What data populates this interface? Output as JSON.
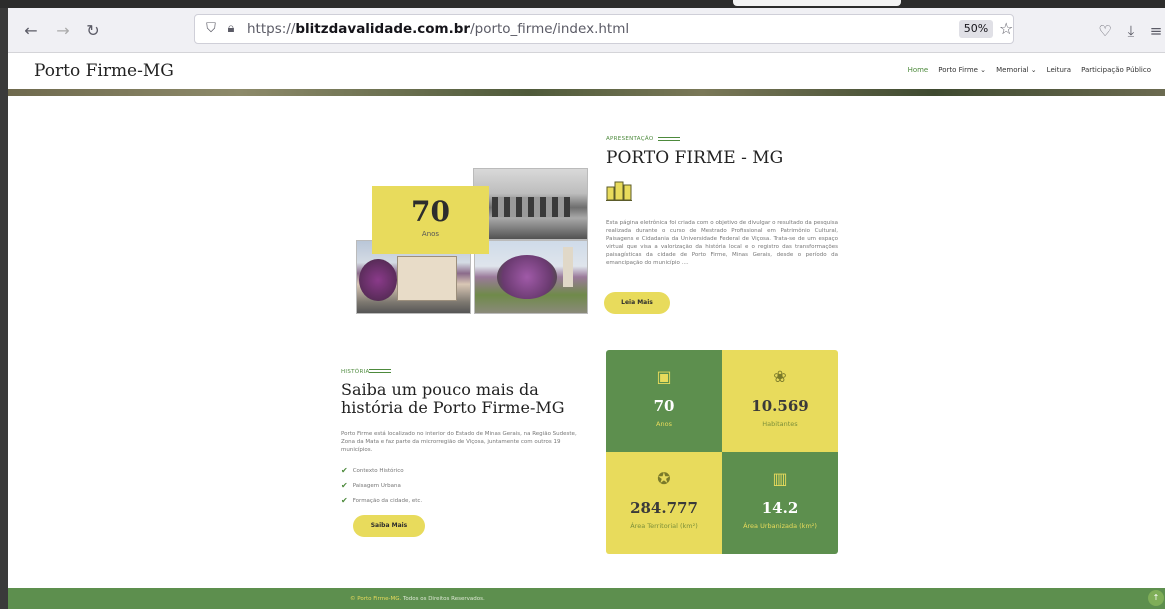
{
  "browser": {
    "back_icon": "arrow-left-icon",
    "forward_icon": "arrow-right-icon",
    "reload_icon": "reload-icon",
    "url_prefix": "https://",
    "url_domain": "blitzdavalidade.com.br",
    "url_path": "/porto_firme/index.html",
    "zoom": "50%"
  },
  "site": {
    "logo": "Porto Firme-MG",
    "nav": [
      "Home",
      "Porto Firme ⌄",
      "Memorial ⌄",
      "Leitura",
      "Participação Público"
    ]
  },
  "years_badge": {
    "value": "70",
    "label": "Anos"
  },
  "intro": {
    "eyebrow": "APRESENTAÇÃO",
    "title": "PORTO FIRME - MG",
    "text": "Esta página eletrônica foi criada com o objetivo de divulgar o resultado da pesquisa realizada durante o curso de Mestrado Profissional em Patrimônio Cultural, Paisagens e Cidadania da Universidade Federal de Viçosa. Trata-se de um espaço virtual que visa a valorização da história local e o registro das transformações paisagísticas da cidade de Porto Firme, Minas Gerais, desde o período da emancipação do município ....",
    "button": "Leia Mais"
  },
  "history": {
    "eyebrow": "HISTÓRIA",
    "title_line1": "Saiba um pouco mais da",
    "title_line2": "história de Porto Firme-MG",
    "text": "Porto Firme está localizado no interior do Estado de Minas Gerais, na Região Sudeste, Zona da Mata e faz parte da microrregião de Viçosa, juntamente com outros 19 municípios.",
    "items": [
      "Contexto Histórico",
      "Paisagem Urbana",
      "Formação da cidade, etc."
    ],
    "button": "Saiba Mais"
  },
  "stats": [
    {
      "value": "70",
      "label": "Anos",
      "icon": "certificate-icon"
    },
    {
      "value": "10.569",
      "label": "Habitantes",
      "icon": "people-icon"
    },
    {
      "value": "284.777",
      "label": "Área Territorial (km²)",
      "icon": "award-icon"
    },
    {
      "value": "14.2",
      "label": "Área Urbanizada (km²)",
      "icon": "city-chart-icon"
    }
  ],
  "footer": {
    "brand": "© Porto Firme-MG.",
    "text": "Todos os Direitos Reservados."
  },
  "colors": {
    "green": "#5d8f4e",
    "yellow": "#e8db5c"
  }
}
